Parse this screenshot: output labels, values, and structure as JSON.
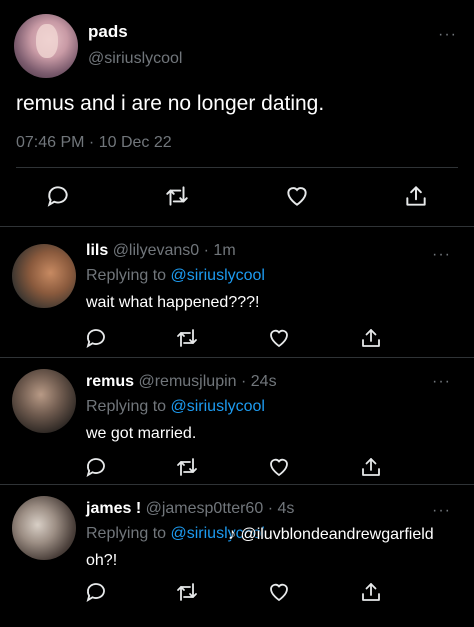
{
  "main_tweet": {
    "name": "pads",
    "handle": "@siriuslycool",
    "text": "remus and i are no longer dating.",
    "timestamp": "07:46 PM · 10 Dec 22",
    "more": "···"
  },
  "replies": [
    {
      "name": "lils",
      "handle": "@lilyevans0",
      "time": "· 1m",
      "replying_prefix": "Replying to",
      "replying_to": "@siriuslycool",
      "text": "wait what happened???!",
      "more": "···"
    },
    {
      "name": "remus",
      "handle": "@remusjlupin",
      "time": "· 24s",
      "replying_prefix": "Replying to",
      "replying_to": "@siriuslycool",
      "text": "we got married.",
      "more": "···"
    },
    {
      "name": "james !",
      "handle": "@jamesp0tter60",
      "time": "· 4s",
      "replying_prefix": "Replying to",
      "replying_to": "@siriuslycool",
      "text": "oh?!",
      "more": "···"
    }
  ],
  "watermark": {
    "handle": "@iluvblondeandrewgarfield"
  },
  "icons": {
    "reply": "reply-icon",
    "retweet": "retweet-icon",
    "like": "heart-icon",
    "share": "share-icon",
    "tiktok": "tiktok-logo-icon"
  },
  "colors": {
    "background": "#000000",
    "text": "#e7e9ea",
    "secondary": "#71767b",
    "link": "#1d9bf0",
    "border": "#2f3336"
  }
}
